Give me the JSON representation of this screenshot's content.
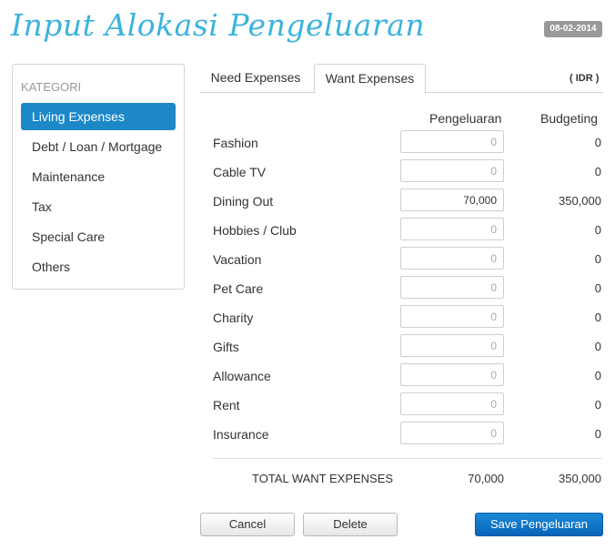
{
  "header": {
    "title": "Input Alokasi Pengeluaran",
    "date": "08-02-2014"
  },
  "sidebar": {
    "heading": "KATEGORI",
    "items": [
      {
        "label": "Living Expenses",
        "active": true
      },
      {
        "label": "Debt / Loan / Mortgage",
        "active": false
      },
      {
        "label": "Maintenance",
        "active": false
      },
      {
        "label": "Tax",
        "active": false
      },
      {
        "label": "Special Care",
        "active": false
      },
      {
        "label": "Others",
        "active": false
      }
    ]
  },
  "tabs": [
    {
      "label": "Need Expenses",
      "active": false
    },
    {
      "label": "Want Expenses",
      "active": true
    }
  ],
  "currency": "( IDR )",
  "table": {
    "headers": {
      "pengeluaran": "Pengeluaran",
      "budgeting": "Budgeting"
    },
    "rows": [
      {
        "label": "Fashion",
        "value": "",
        "placeholder": "0",
        "budget": "0"
      },
      {
        "label": "Cable TV",
        "value": "",
        "placeholder": "0",
        "budget": "0"
      },
      {
        "label": "Dining Out",
        "value": "70,000",
        "placeholder": "0",
        "budget": "350,000"
      },
      {
        "label": "Hobbies / Club",
        "value": "",
        "placeholder": "0",
        "budget": "0"
      },
      {
        "label": "Vacation",
        "value": "",
        "placeholder": "0",
        "budget": "0"
      },
      {
        "label": "Pet Care",
        "value": "",
        "placeholder": "0",
        "budget": "0"
      },
      {
        "label": "Charity",
        "value": "",
        "placeholder": "0",
        "budget": "0"
      },
      {
        "label": "Gifts",
        "value": "",
        "placeholder": "0",
        "budget": "0"
      },
      {
        "label": "Allowance",
        "value": "",
        "placeholder": "0",
        "budget": "0"
      },
      {
        "label": "Rent",
        "value": "",
        "placeholder": "0",
        "budget": "0"
      },
      {
        "label": "Insurance",
        "value": "",
        "placeholder": "0",
        "budget": "0"
      }
    ],
    "total": {
      "label": "TOTAL WANT EXPENSES",
      "pengeluaran": "70,000",
      "budgeting": "350,000"
    }
  },
  "buttons": {
    "cancel": "Cancel",
    "delete": "Delete",
    "save": "Save Pengeluaran"
  },
  "colors": {
    "accent": "#1c88c8",
    "title": "#3bb3dc",
    "save_button": "#0964b8"
  }
}
